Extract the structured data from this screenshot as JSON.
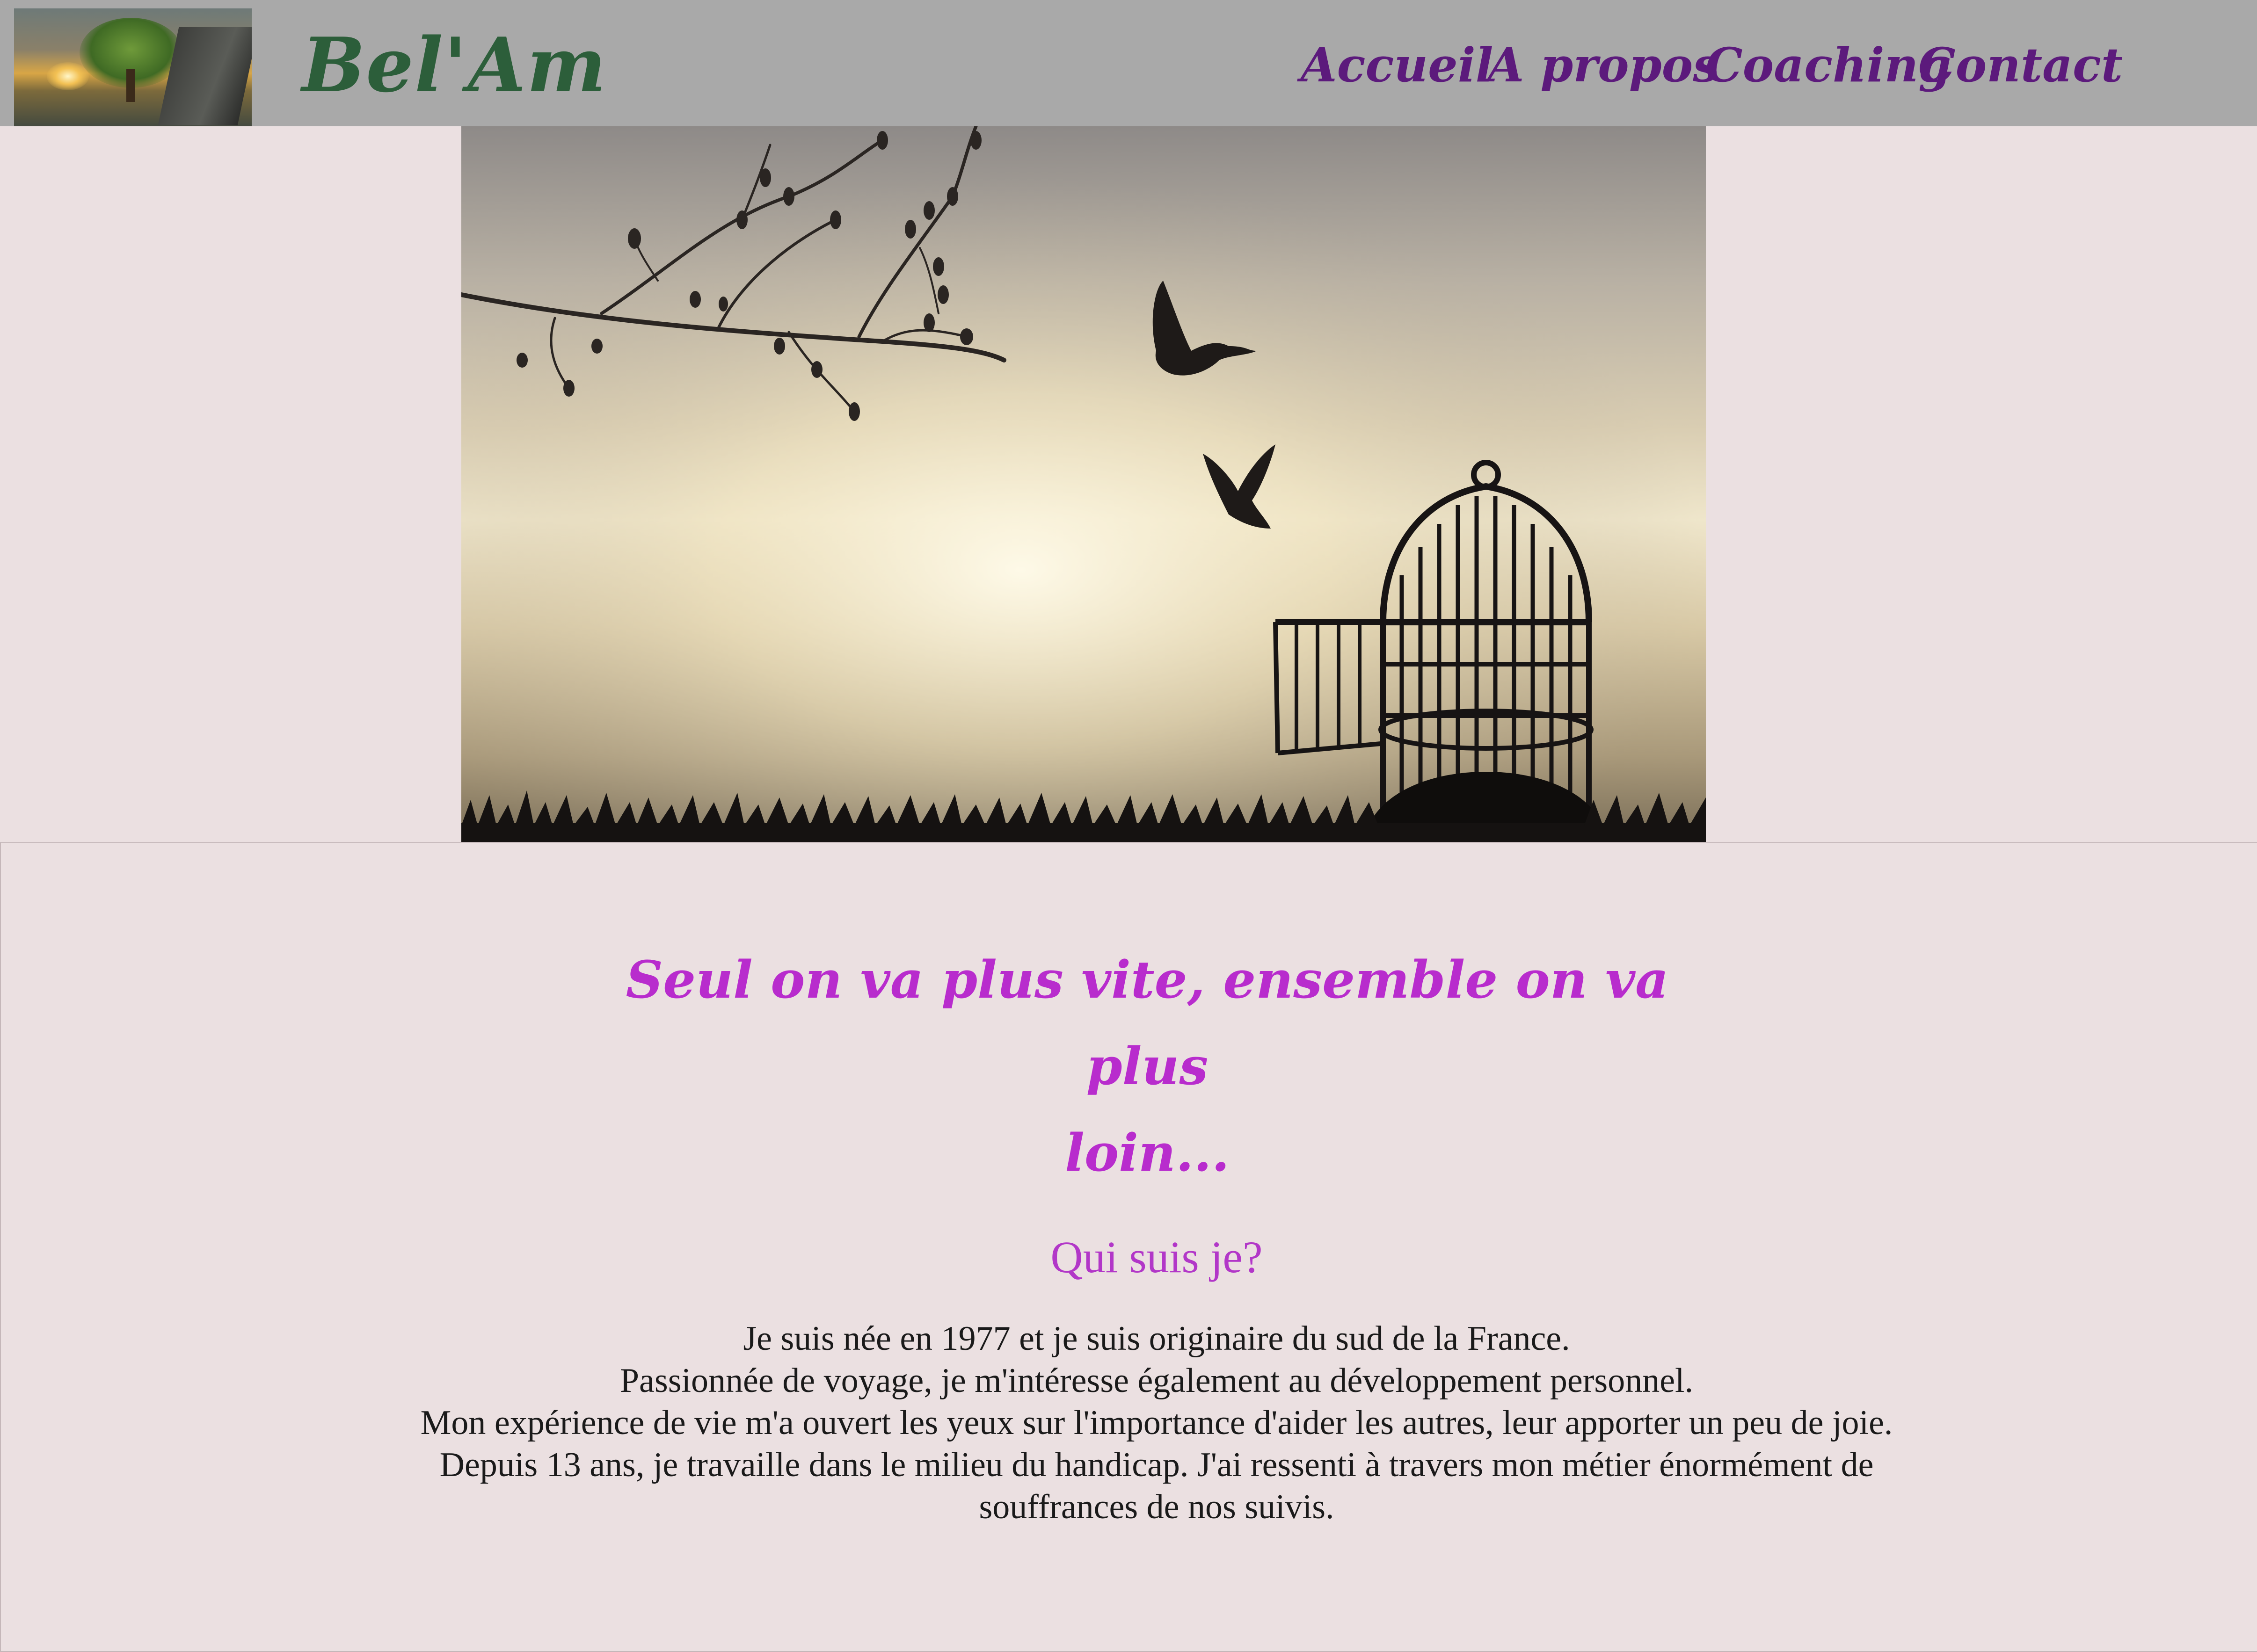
{
  "header": {
    "brand": "Bel'Am",
    "logo_alt": "tree-and-book-logo",
    "nav": {
      "accueil": "Accueil",
      "apropos": "A propos",
      "coaching": "Coaching",
      "contact": "Contact"
    }
  },
  "hero": {
    "image": "birds-leaving-open-cage-silhouette"
  },
  "main": {
    "quote_line1": "Seul on va plus vite, ensemble on va plus",
    "quote_line2": "loin...",
    "about_title": "Qui suis je?",
    "about_lines": [
      "Je suis née en 1977 et je suis originaire du sud de la France.",
      "Passionnée de voyage, je m'intéresse également au développement personnel.",
      "Mon expérience de vie m'a ouvert les yeux sur l'importance d'aider les autres, leur apporter un peu de joie.",
      "Depuis 13 ans, je travaille dans le milieu du handicap. J'ai ressenti à travers mon métier énormément de souffrances de nos suivis."
    ]
  },
  "colors": {
    "header_bg": "#a9a9a9",
    "page_bg": "#ebe0e1",
    "brand": "#2c5e3a",
    "nav": "#5c1a7c",
    "accent": "#b82ccd"
  }
}
